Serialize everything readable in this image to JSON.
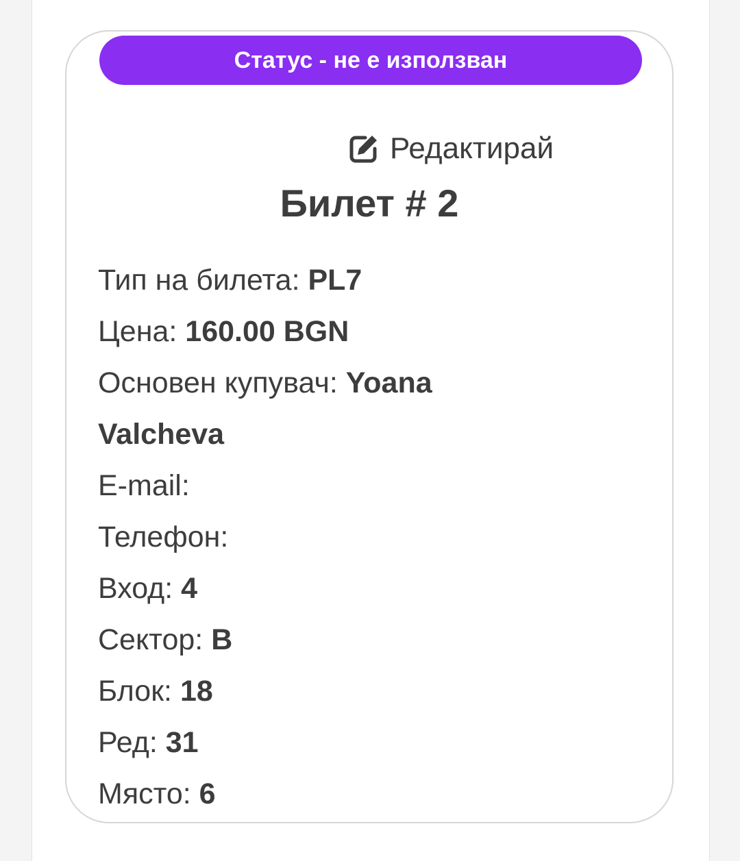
{
  "status": {
    "label": "Статус - не е използван"
  },
  "edit": {
    "label": "Редактирай",
    "icon": "edit-icon"
  },
  "ticket": {
    "title": "Билет # 2"
  },
  "details": {
    "ticket_type": {
      "label": "Тип на билета: ",
      "value": "PL7"
    },
    "price": {
      "label": "Цена: ",
      "value": "160.00 BGN"
    },
    "buyer": {
      "label": "Основен купувач: ",
      "value": "Yoana Valcheva"
    },
    "email": {
      "label": "E-mail: ",
      "value": ""
    },
    "phone": {
      "label": "Телефон: ",
      "value": ""
    },
    "entrance": {
      "label": "Вход: ",
      "value": "4"
    },
    "sector": {
      "label": "Сектор: ",
      "value": "B"
    },
    "block": {
      "label": "Блок: ",
      "value": "18"
    },
    "row": {
      "label": "Ред: ",
      "value": "31"
    },
    "seat": {
      "label": "Място: ",
      "value": "6"
    }
  },
  "colors": {
    "accent": "#8a2ef2",
    "text": "#3d3d3d",
    "card_border": "#d6d6d6"
  }
}
